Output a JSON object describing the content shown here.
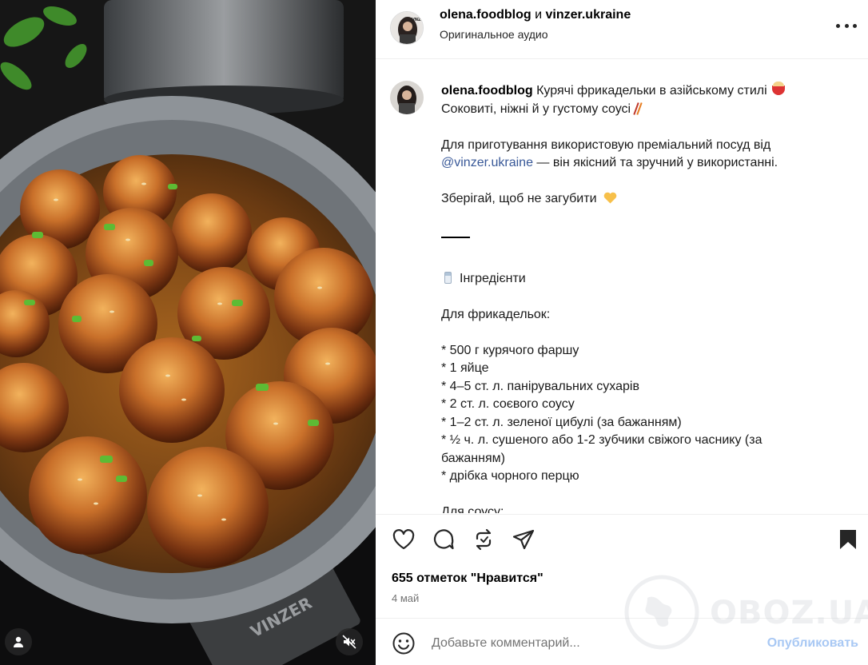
{
  "post": {
    "author": "olena.foodblog",
    "conjunction": "и",
    "collaborator": "vinzer.ukraine",
    "audio": "Оригинальное аудио",
    "brand_on_pan": "VINZER"
  },
  "caption": {
    "user": "olena.foodblog",
    "title_text": "Курячі фрикадельки в азійському стилі",
    "line2": "Соковиті, ніжні й у густому соусі",
    "p2_line1": "Для приготування використовую преміальний посуд від",
    "p2_link": "@vinzer.ukraine",
    "p2_rest": " — він якісний та зручний у використанні.",
    "save_text": "Зберігай, щоб не загубити",
    "ingredients_heading": "Інгредієнти",
    "meatballs_heading": "Для фрикадельок:",
    "ingredients": [
      "* 500 г курячого фаршу",
      "* 1 яйце",
      "* 4–5 ст. л. панірувальних сухарів",
      "* 2 ст. л. соєвого соусу",
      "* 1–2 ст. л. зеленої цибулі (за бажанням)",
      "* ½ ч. л. сушеного або 1-2 зубчики свіжого часнику (за",
      "бажанням)",
      "* дрібка чорного перцю"
    ],
    "sauce_heading": "Для соусу:"
  },
  "actions": {
    "likes": "655 отметок \"Нравится\"",
    "date": "4 май"
  },
  "comment": {
    "placeholder": "Добавьте комментарий...",
    "publish": "Опубликовать"
  },
  "watermark": "OBOZ.UA",
  "colors": {
    "link": "#385898",
    "publish_disabled": "#a8c8f4",
    "muted_text": "#737373"
  },
  "icons": [
    "user-tag-icon",
    "mute-icon",
    "more-icon",
    "heart-icon",
    "comment-icon",
    "repost-icon",
    "share-icon",
    "bookmark-icon",
    "emoji-icon"
  ]
}
